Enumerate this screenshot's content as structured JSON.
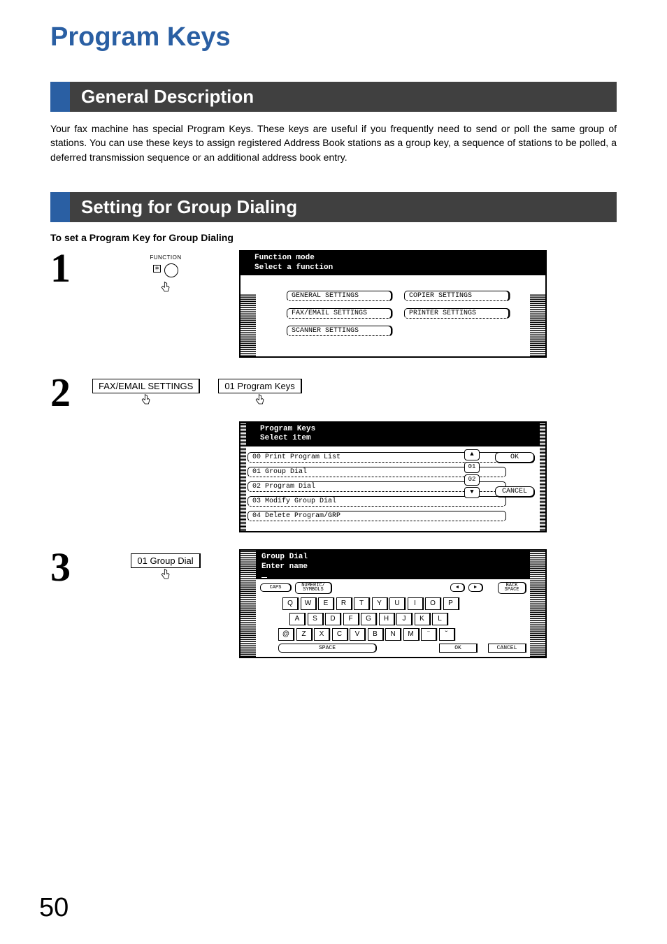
{
  "page_title": "Program Keys",
  "page_number": "50",
  "sections": {
    "general": {
      "heading": "General Description",
      "body": "Your fax machine has special Program Keys. These keys are useful if you frequently need to send or poll the same group of stations. You can use these keys to assign registered Address Book stations as a group key, a sequence of stations to be polled, a deferred transmission sequence or an additional address book entry."
    },
    "group_dialing": {
      "heading": "Setting for Group Dialing",
      "subheading": "To set a Program Key for Group Dialing"
    }
  },
  "steps": {
    "s1": {
      "number": "1",
      "action_label": "FUNCTION",
      "asterisk": "＊",
      "screen": {
        "title1": "Function mode",
        "title2": "Select a function",
        "buttons": {
          "general": "GENERAL SETTINGS",
          "copier": "COPIER SETTINGS",
          "faxemail": "FAX/EMAIL SETTINGS",
          "printer": "PRINTER SETTINGS",
          "scanner": "SCANNER SETTINGS"
        }
      }
    },
    "s2": {
      "number": "2",
      "action1": "FAX/EMAIL SETTINGS",
      "action2": "01 Program Keys",
      "screen": {
        "title1": "Program Keys",
        "title2": "Select item",
        "items": {
          "i0": "00  Print Program List",
          "i1": "01  Group Dial",
          "i2": "02  Program Dial",
          "i3": "03  Modify Group Dial",
          "i4": "04  Delete Program/GRP"
        },
        "scroll": {
          "n01": "01",
          "n02": "02"
        },
        "ok": "OK",
        "cancel": "CANCEL"
      }
    },
    "s3": {
      "number": "3",
      "action1": "01 Group Dial",
      "screen": {
        "title1": "Group Dial",
        "title2": "Enter name",
        "toprow": {
          "caps": "CAPS",
          "numeric": "NUMERIC/\nSYMBOLS",
          "left": "◄",
          "right": "►",
          "back": "BACK\nSPACE"
        },
        "row1": [
          "Q",
          "W",
          "E",
          "R",
          "T",
          "Y",
          "U",
          "I",
          "O",
          "P"
        ],
        "row2": [
          "A",
          "S",
          "D",
          "F",
          "G",
          "H",
          "J",
          "K",
          "L"
        ],
        "row3": [
          "@",
          "Z",
          "X",
          "C",
          "V",
          "B",
          "N",
          "M",
          "¨",
          "˘"
        ],
        "bottom": {
          "space": "SPACE",
          "ok": "OK",
          "cancel": "CANCEL"
        }
      }
    }
  }
}
